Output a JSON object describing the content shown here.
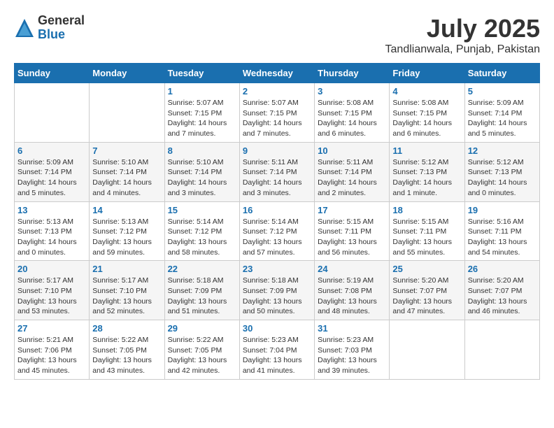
{
  "header": {
    "logo_general": "General",
    "logo_blue": "Blue",
    "month_title": "July 2025",
    "location": "Tandlianwala, Punjab, Pakistan"
  },
  "weekdays": [
    "Sunday",
    "Monday",
    "Tuesday",
    "Wednesday",
    "Thursday",
    "Friday",
    "Saturday"
  ],
  "weeks": [
    [
      {
        "day": "",
        "info": ""
      },
      {
        "day": "",
        "info": ""
      },
      {
        "day": "1",
        "info": "Sunrise: 5:07 AM\nSunset: 7:15 PM\nDaylight: 14 hours and 7 minutes."
      },
      {
        "day": "2",
        "info": "Sunrise: 5:07 AM\nSunset: 7:15 PM\nDaylight: 14 hours and 7 minutes."
      },
      {
        "day": "3",
        "info": "Sunrise: 5:08 AM\nSunset: 7:15 PM\nDaylight: 14 hours and 6 minutes."
      },
      {
        "day": "4",
        "info": "Sunrise: 5:08 AM\nSunset: 7:15 PM\nDaylight: 14 hours and 6 minutes."
      },
      {
        "day": "5",
        "info": "Sunrise: 5:09 AM\nSunset: 7:14 PM\nDaylight: 14 hours and 5 minutes."
      }
    ],
    [
      {
        "day": "6",
        "info": "Sunrise: 5:09 AM\nSunset: 7:14 PM\nDaylight: 14 hours and 5 minutes."
      },
      {
        "day": "7",
        "info": "Sunrise: 5:10 AM\nSunset: 7:14 PM\nDaylight: 14 hours and 4 minutes."
      },
      {
        "day": "8",
        "info": "Sunrise: 5:10 AM\nSunset: 7:14 PM\nDaylight: 14 hours and 3 minutes."
      },
      {
        "day": "9",
        "info": "Sunrise: 5:11 AM\nSunset: 7:14 PM\nDaylight: 14 hours and 3 minutes."
      },
      {
        "day": "10",
        "info": "Sunrise: 5:11 AM\nSunset: 7:14 PM\nDaylight: 14 hours and 2 minutes."
      },
      {
        "day": "11",
        "info": "Sunrise: 5:12 AM\nSunset: 7:13 PM\nDaylight: 14 hours and 1 minute."
      },
      {
        "day": "12",
        "info": "Sunrise: 5:12 AM\nSunset: 7:13 PM\nDaylight: 14 hours and 0 minutes."
      }
    ],
    [
      {
        "day": "13",
        "info": "Sunrise: 5:13 AM\nSunset: 7:13 PM\nDaylight: 14 hours and 0 minutes."
      },
      {
        "day": "14",
        "info": "Sunrise: 5:13 AM\nSunset: 7:12 PM\nDaylight: 13 hours and 59 minutes."
      },
      {
        "day": "15",
        "info": "Sunrise: 5:14 AM\nSunset: 7:12 PM\nDaylight: 13 hours and 58 minutes."
      },
      {
        "day": "16",
        "info": "Sunrise: 5:14 AM\nSunset: 7:12 PM\nDaylight: 13 hours and 57 minutes."
      },
      {
        "day": "17",
        "info": "Sunrise: 5:15 AM\nSunset: 7:11 PM\nDaylight: 13 hours and 56 minutes."
      },
      {
        "day": "18",
        "info": "Sunrise: 5:15 AM\nSunset: 7:11 PM\nDaylight: 13 hours and 55 minutes."
      },
      {
        "day": "19",
        "info": "Sunrise: 5:16 AM\nSunset: 7:11 PM\nDaylight: 13 hours and 54 minutes."
      }
    ],
    [
      {
        "day": "20",
        "info": "Sunrise: 5:17 AM\nSunset: 7:10 PM\nDaylight: 13 hours and 53 minutes."
      },
      {
        "day": "21",
        "info": "Sunrise: 5:17 AM\nSunset: 7:10 PM\nDaylight: 13 hours and 52 minutes."
      },
      {
        "day": "22",
        "info": "Sunrise: 5:18 AM\nSunset: 7:09 PM\nDaylight: 13 hours and 51 minutes."
      },
      {
        "day": "23",
        "info": "Sunrise: 5:18 AM\nSunset: 7:09 PM\nDaylight: 13 hours and 50 minutes."
      },
      {
        "day": "24",
        "info": "Sunrise: 5:19 AM\nSunset: 7:08 PM\nDaylight: 13 hours and 48 minutes."
      },
      {
        "day": "25",
        "info": "Sunrise: 5:20 AM\nSunset: 7:07 PM\nDaylight: 13 hours and 47 minutes."
      },
      {
        "day": "26",
        "info": "Sunrise: 5:20 AM\nSunset: 7:07 PM\nDaylight: 13 hours and 46 minutes."
      }
    ],
    [
      {
        "day": "27",
        "info": "Sunrise: 5:21 AM\nSunset: 7:06 PM\nDaylight: 13 hours and 45 minutes."
      },
      {
        "day": "28",
        "info": "Sunrise: 5:22 AM\nSunset: 7:05 PM\nDaylight: 13 hours and 43 minutes."
      },
      {
        "day": "29",
        "info": "Sunrise: 5:22 AM\nSunset: 7:05 PM\nDaylight: 13 hours and 42 minutes."
      },
      {
        "day": "30",
        "info": "Sunrise: 5:23 AM\nSunset: 7:04 PM\nDaylight: 13 hours and 41 minutes."
      },
      {
        "day": "31",
        "info": "Sunrise: 5:23 AM\nSunset: 7:03 PM\nDaylight: 13 hours and 39 minutes."
      },
      {
        "day": "",
        "info": ""
      },
      {
        "day": "",
        "info": ""
      }
    ]
  ]
}
